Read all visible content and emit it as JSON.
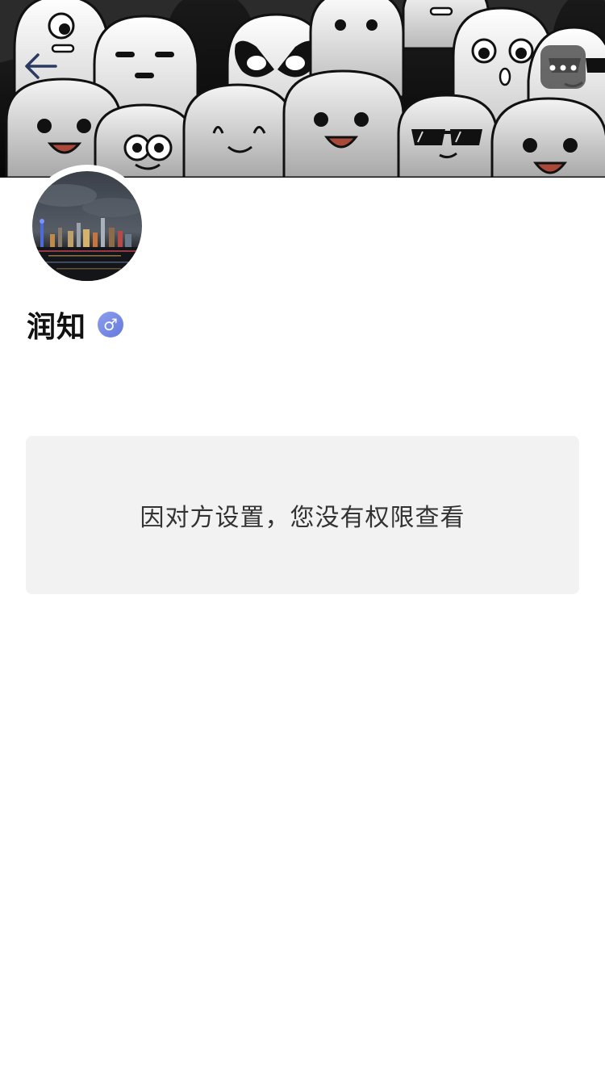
{
  "header": {
    "back_icon": "arrow-left-icon",
    "more_icon": "more-dots-icon"
  },
  "profile": {
    "name": "润知",
    "gender_symbol": "♂",
    "gender_color": "#7b8ee6"
  },
  "notice": {
    "message": "因对方设置，您没有权限查看"
  },
  "colors": {
    "notice_background": "#f2f2f2",
    "text_primary": "#111111",
    "text_secondary": "#333333"
  }
}
